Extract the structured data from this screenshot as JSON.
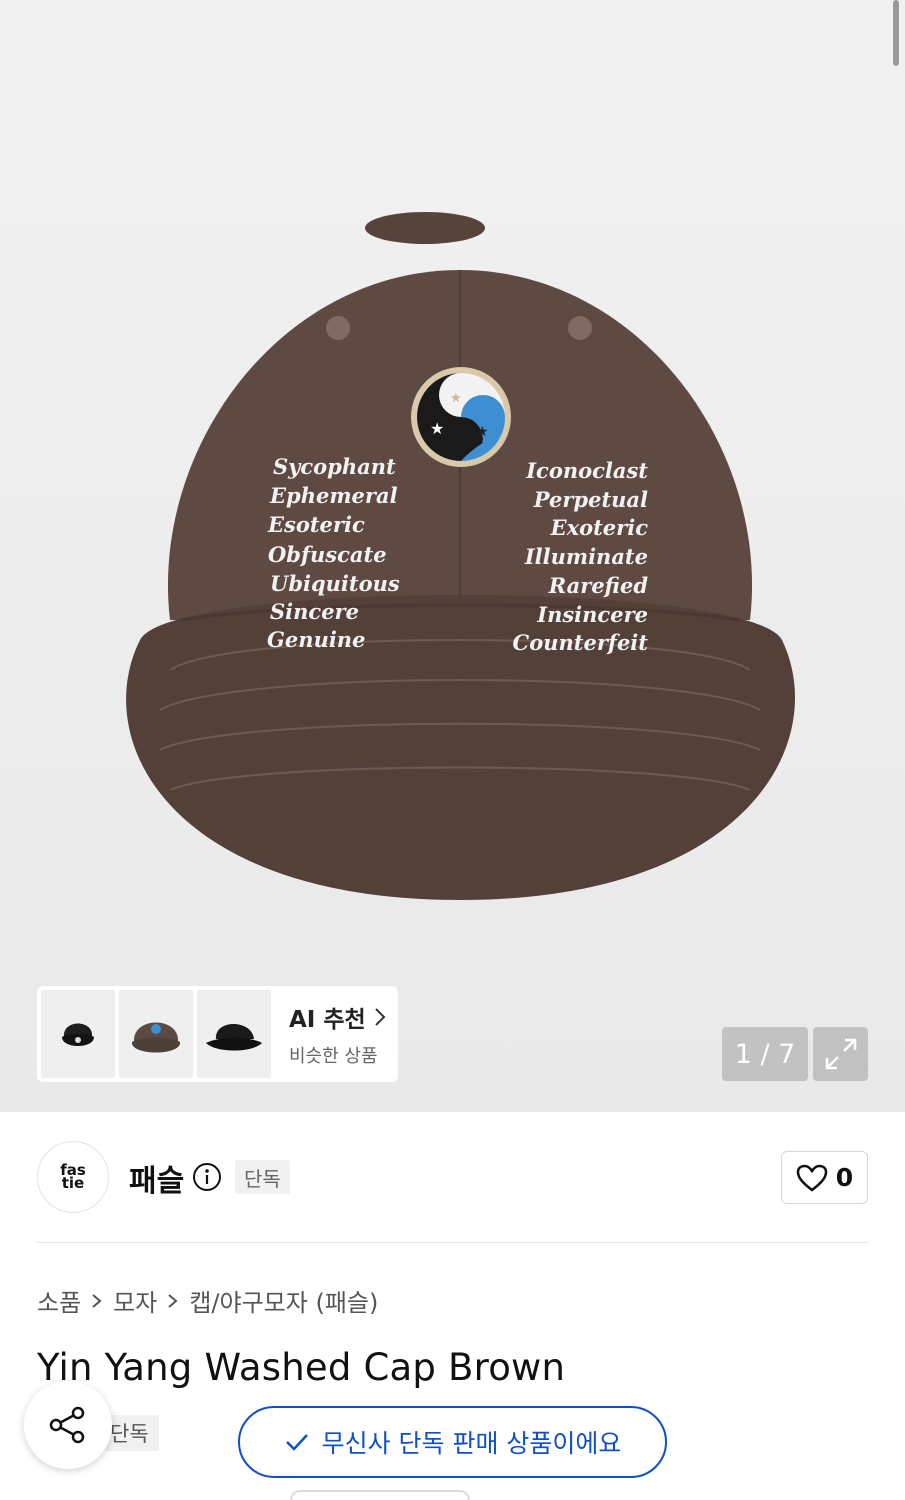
{
  "gallery": {
    "counter": "1 / 7",
    "hat_left_words": [
      "Sycophant",
      "Ephemeral",
      "Esoteric",
      "Obfuscate",
      "Ubiquitous",
      "Sincere",
      "Genuine"
    ],
    "hat_right_words": [
      "Iconoclast",
      "Perpetual",
      "Exoteric",
      "Illuminate",
      "Rarefied",
      "Insincere",
      "Counterfeit"
    ],
    "recommendation": {
      "title": "AI 추천",
      "subtitle": "비슷한 상품"
    }
  },
  "brand": {
    "logo_line1": "fas",
    "logo_line2": "tie",
    "name": "패슬",
    "badge": "단독",
    "like_count": "0"
  },
  "breadcrumb": [
    "소품",
    "모자",
    "캡/야구모자 (패슬)"
  ],
  "product": {
    "title": "Yin Yang Washed Cap Brown",
    "tag": "단독"
  },
  "toast": {
    "message": "무신사 단독 판매 상품이에요"
  },
  "colors": {
    "accent": "#0f4fc7",
    "hat_brown": "#5e4a42"
  }
}
